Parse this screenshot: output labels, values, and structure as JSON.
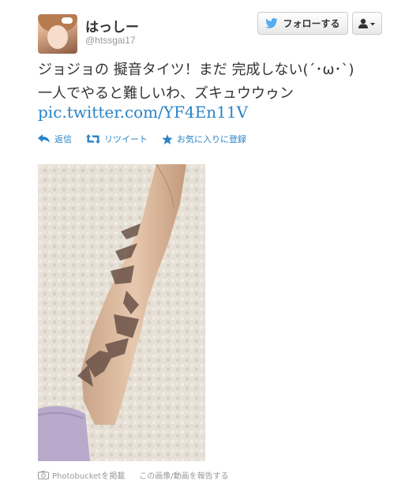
{
  "user": {
    "name": "はっしー",
    "handle": "@htssgai17"
  },
  "header": {
    "follow_label": "フォローする"
  },
  "tweet": {
    "line1": "ジョジョの 擬音タイツ！まだ 完成しない(´･ω･`)",
    "line2": "一人でやると難しいわ、ズキュウウゥン",
    "link": "pic.twitter.com/YF4En11V"
  },
  "actions": {
    "reply": "返信",
    "retweet": "リツイート",
    "favorite": "お気に入りに登録"
  },
  "footer": {
    "photo_source": "Photobucketを掲載",
    "report": "この画像/動画を報告する"
  },
  "colors": {
    "link": "#2a84c5",
    "twitter_bird": "#55acee",
    "muted": "#999999"
  }
}
